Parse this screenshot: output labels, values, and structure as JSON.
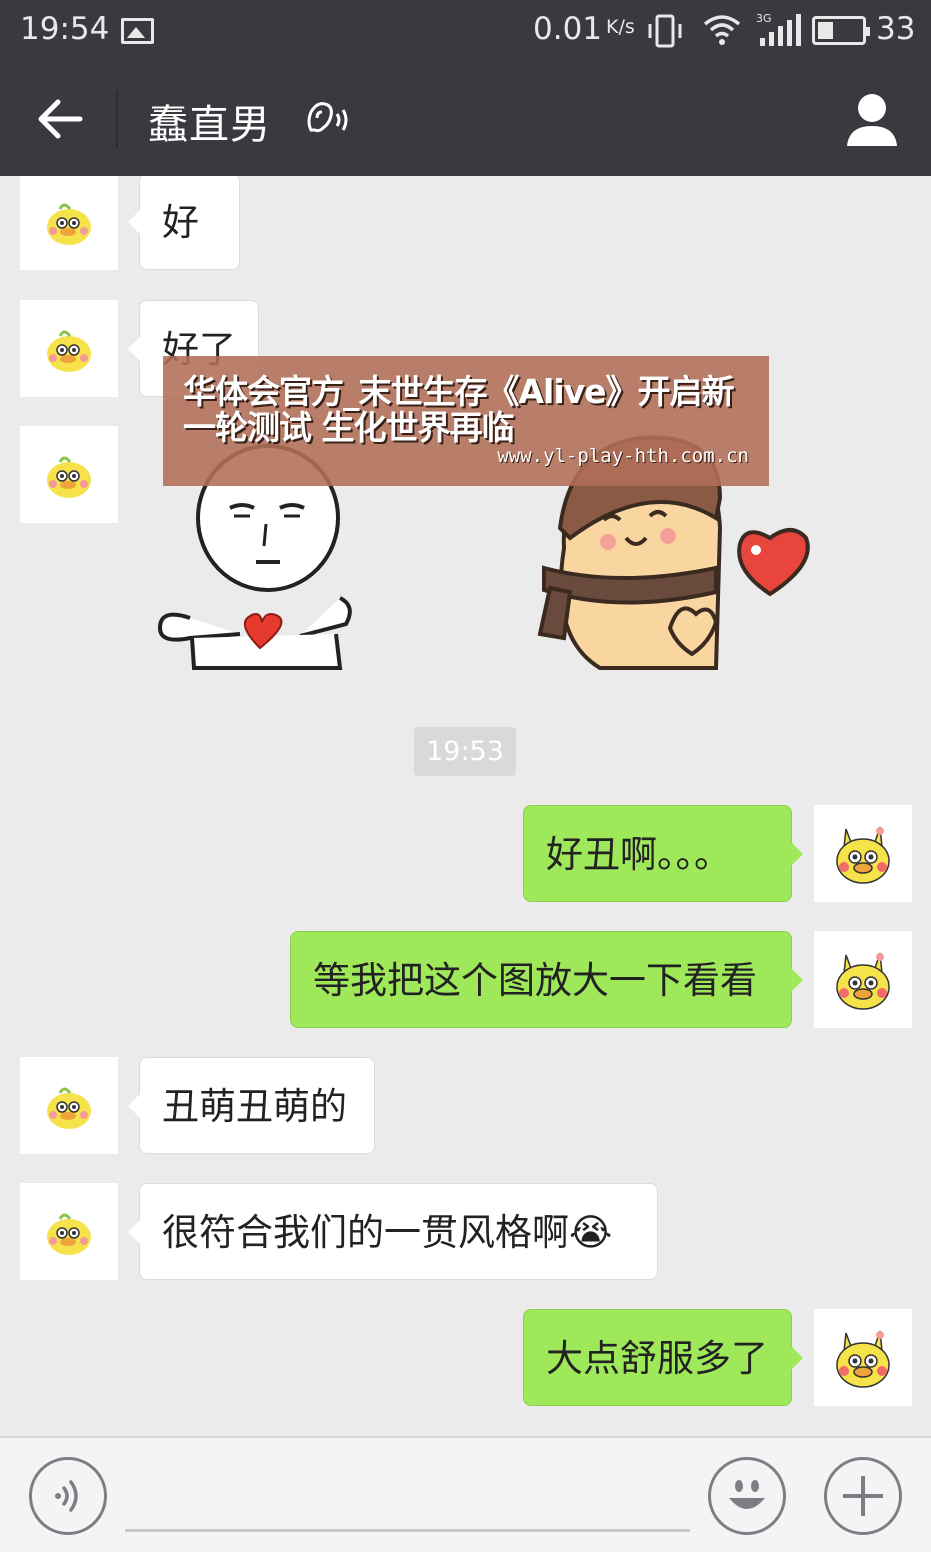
{
  "status_bar": {
    "time": "19:54",
    "network_speed": "0.01",
    "speed_unit": "K/s",
    "network_type": "3G",
    "battery": "33",
    "icons": [
      "image-icon",
      "vibrate-icon",
      "wifi-icon",
      "signal-icon",
      "battery-icon"
    ]
  },
  "header": {
    "title": "蠢直男",
    "icons": [
      "back-arrow-icon",
      "earpiece-mode-icon",
      "profile-icon"
    ],
    "bg_color": "#393a3f"
  },
  "chat": {
    "messages": [
      {
        "side": "in",
        "text": "好"
      },
      {
        "side": "in",
        "text": "好了"
      },
      {
        "side": "in",
        "type": "sticker"
      },
      {
        "side": "out",
        "text": "好丑啊。。。"
      },
      {
        "side": "out",
        "text": "等我把这个图放大一下看看"
      },
      {
        "side": "in",
        "text": "丑萌丑萌的"
      },
      {
        "side": "in",
        "text": "很符合我们的一贯风格啊😭"
      },
      {
        "side": "out",
        "text": "大点舒服多了"
      }
    ],
    "timestamp": "19:53",
    "watermark": {
      "title": "华体会官方_末世生存《Alive》开启新一轮测试 生化世界再临",
      "url": "www.yl-play-hth.com.cn"
    },
    "colors": {
      "incoming": "#ffffff",
      "outgoing": "#9fe85a",
      "background": "#ebebeb"
    }
  },
  "input_bar": {
    "icons": [
      "voice-input-icon",
      "emoji-icon",
      "plus-icon"
    ],
    "input_value": ""
  }
}
